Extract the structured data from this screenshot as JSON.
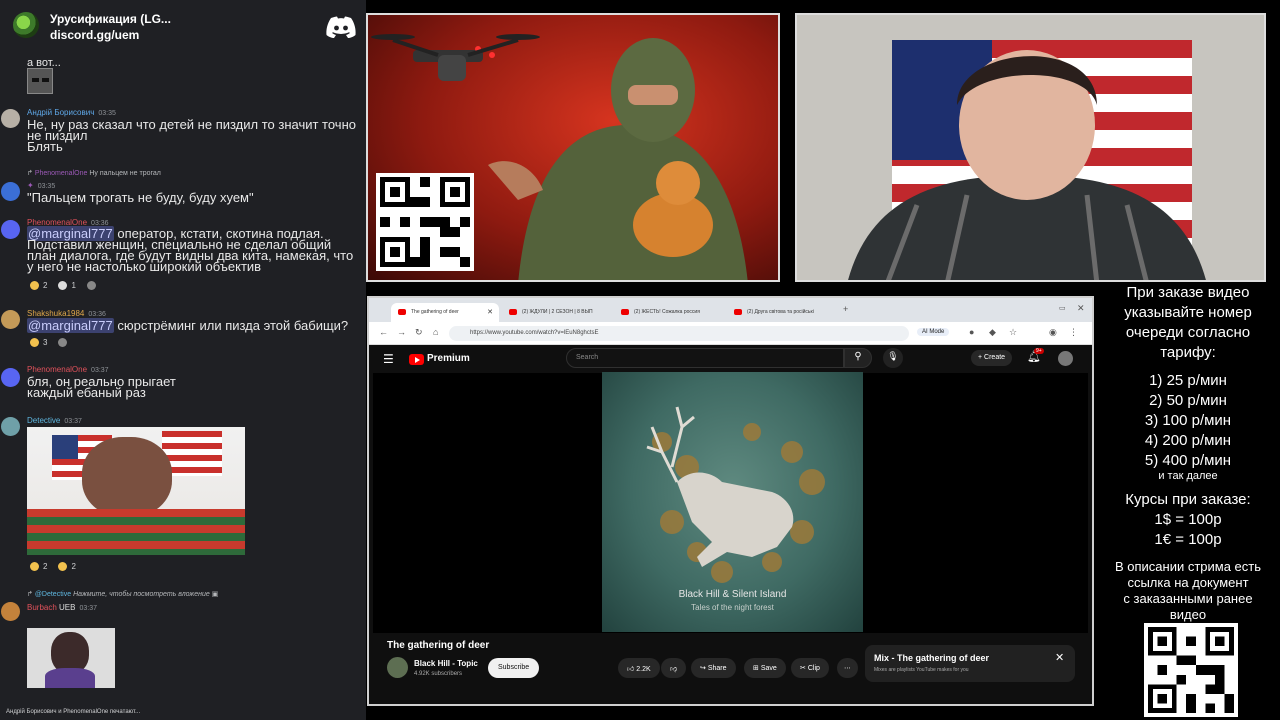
{
  "discord": {
    "server_name": "Урусификация (LG...",
    "invite": "discord.gg/uem",
    "top_fragment": "а вот...",
    "messages": [
      {
        "author": "Андрій Борисович",
        "author_color": "#5fa8e8",
        "time": "03:35",
        "text": "Не, ну раз сказал что детей не пиздил то значит точно\nне пиздил\nБлять"
      },
      {
        "reply_author": "PhenomenalOne",
        "reply_text": "Ну пальцем не трогал",
        "time": "03:35",
        "text": "\"Пальцем трогать не буду, буду хуем\""
      },
      {
        "author": "PhenomenalOne",
        "author_color": "#e0515b",
        "time": "03:36",
        "mention": "@marginal777",
        "text": " оператор, кстати, скотина подлая.\nПодставил женщин, специально не сделал общий\nплан диалога, где будут видны два кита, намекая, что\nу него не настолько широкий объектив",
        "reactions": [
          "2",
          "1",
          ""
        ]
      },
      {
        "author": "Shakshuka1984",
        "author_color": "#e0a84a",
        "time": "03:36",
        "mention": "@marginal777",
        "text": " сюрстрёминг или пизда этой бабищи?",
        "reactions": [
          "3",
          ""
        ]
      },
      {
        "author": "PhenomenalOne",
        "author_color": "#e0515b",
        "time": "03:37",
        "text": "бля, он реально прыгает\nкаждый ебаный раз"
      },
      {
        "author": "Detective",
        "author_color": "#5fb7e0",
        "time": "03:37",
        "reactions": [
          "2",
          "2"
        ]
      },
      {
        "reply_author": "@Detective",
        "reply_text": "Нажмите, чтобы посмотреть вложение",
        "author": "Burbach",
        "author_color": "#e0515b",
        "tag": "UEB",
        "time": "03:37"
      }
    ],
    "footer": "Андрій Борисович и PhenomenalOne печатают..."
  },
  "browser": {
    "tabs": [
      {
        "label": "The gathering of deer",
        "active": true
      },
      {
        "label": "(2) ЖДУЛИ | 2 СЕЗОН | 8 ВЫП",
        "active": false
      },
      {
        "label": "(2) ЖЕСТЬ! Сожалка россия",
        "active": false
      },
      {
        "label": "(2) Друга світова та російські",
        "active": false
      }
    ],
    "url": "https://www.youtube.com/watch?v=lEuN8ghctsE",
    "ai_mode": "AI Mode"
  },
  "youtube": {
    "brand": "Premium",
    "search_placeholder": "Search",
    "create_label": "Create",
    "notifications": "9+",
    "cover_title": "Black Hill & Silent Island",
    "cover_subtitle": "Tales of the night forest",
    "video_title": "The gathering of deer",
    "channel": "Black Hill - Topic",
    "subscribers": "4.92K subscribers",
    "subscribe_label": "Subscribe",
    "likes": "2.2K",
    "share_label": "Share",
    "save_label": "Save",
    "clip_label": "Clip",
    "mix_title": "Mix - The gathering of deer",
    "mix_subtitle": "Mixes are playlists YouTube makes for you"
  },
  "info_panel": {
    "heading_lines": [
      "При заказе видео",
      "указывайте номер",
      "очереди согласно",
      "тарифу:"
    ],
    "tariffs": [
      "1) 25 р/мин",
      "2) 50 р/мин",
      "3) 100 р/мин",
      "4) 200 р/мин",
      "5) 400 р/мин"
    ],
    "tariffs_more": "и так далее",
    "rates_heading": "Курсы при заказе:",
    "rates": [
      "1$ = 100р",
      "1€ = 100р"
    ],
    "description_lines": [
      "В описании стрима есть",
      "ссылка на документ",
      "с заказанными ранее",
      "видео"
    ]
  },
  "colors": {
    "chat_bg": "#1f2024",
    "discord_blurple": "#5865f2",
    "youtube_red": "#ff0000",
    "player_bg": "#0f0f0f"
  }
}
